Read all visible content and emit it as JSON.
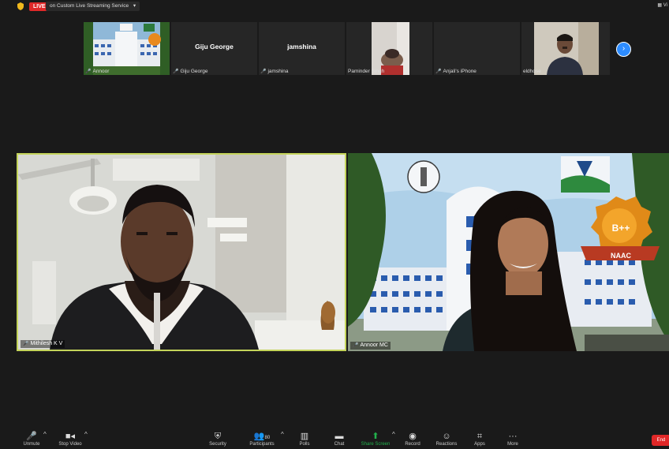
{
  "topbar": {
    "live_label": "LIVE",
    "stream_label": "on Custom Live Streaming Service",
    "view_label": "Vi"
  },
  "strip": {
    "tiles": [
      {
        "name": "Annoor",
        "muted": true,
        "type": "image"
      },
      {
        "name": "Giju George",
        "muted": true,
        "type": "name",
        "center_name": "Giju George"
      },
      {
        "name": "jamshina",
        "muted": true,
        "type": "name",
        "center_name": "jamshina"
      },
      {
        "name": "Paminder Singh",
        "muted": false,
        "type": "video"
      },
      {
        "name": "Anjali's iPhone",
        "muted": true,
        "type": "blank"
      },
      {
        "name": "eldhose",
        "muted": false,
        "type": "video"
      }
    ]
  },
  "videos": {
    "left": {
      "name": "Mithilesh K V"
    },
    "right": {
      "name": "Annoor MC",
      "badge": "B++",
      "badge_sub": "NAAC"
    }
  },
  "toolbar": {
    "unmute": "Unmute",
    "stop_video": "Stop Video",
    "security": "Security",
    "participants": "Participants",
    "participants_count": "80",
    "polls": "Polls",
    "chat": "Chat",
    "share_screen": "Share Screen",
    "record": "Record",
    "reactions": "Reactions",
    "apps": "Apps",
    "more": "More",
    "end": "End"
  },
  "colors": {
    "background": "#1a1a1a",
    "accent": "#2d8cff",
    "active_speaker": "#c4d45a",
    "danger": "#e02828",
    "share_green": "#22b14c"
  }
}
